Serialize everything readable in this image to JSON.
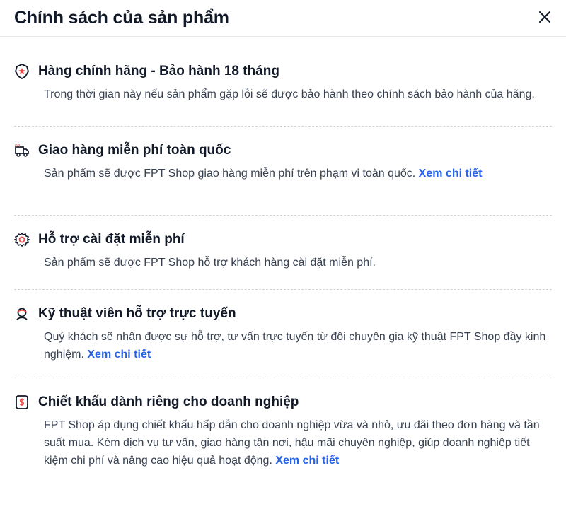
{
  "modal": {
    "title": "Chính sách của sản phẩm",
    "close_icon": "close-icon"
  },
  "items": [
    {
      "icon": "authentic-badge-icon",
      "title": "Hàng chính hãng - Bảo hành 18 tháng",
      "desc": "Trong thời gian này nếu sản phẩm gặp lỗi sẽ được bảo hành theo chính sách bảo hành của hãng.",
      "link": ""
    },
    {
      "icon": "delivery-truck-icon",
      "title": "Giao hàng miễn phí toàn quốc",
      "desc": "Sản phẩm sẽ được FPT Shop giao hàng miễn phí trên phạm vi toàn quốc.",
      "link": "Xem chi tiết"
    },
    {
      "icon": "gear-icon",
      "title": "Hỗ trợ cài đặt miễn phí",
      "desc": "Sản phẩm sẽ được FPT Shop hỗ trợ khách hàng cài đặt miễn phí.",
      "link": ""
    },
    {
      "icon": "support-technician-icon",
      "title": "Kỹ thuật viên hỗ trợ trực tuyến",
      "desc": "Quý khách sẽ nhận được sự hỗ trợ, tư vấn trực tuyến từ đội chuyên gia kỹ thuật FPT Shop đầy kinh nghiệm.",
      "link": "Xem chi tiết"
    },
    {
      "icon": "discount-dollar-icon",
      "title": "Chiết khấu dành riêng cho doanh nghiệp",
      "desc": "FPT Shop áp dụng chiết khấu hấp dẫn cho doanh nghiệp vừa và nhỏ, ưu đãi theo đơn hàng và tần suất mua. Kèm dịch vụ tư vấn, giao hàng tận nơi, hậu mãi chuyên nghiệp, giúp doanh nghiệp tiết kiệm chi phí và nâng cao hiệu quả hoạt động.",
      "link": "Xem chi tiết"
    }
  ],
  "colors": {
    "link": "#2563eb",
    "text": "#111827",
    "muted": "#374151",
    "divider": "#d1d5db"
  }
}
